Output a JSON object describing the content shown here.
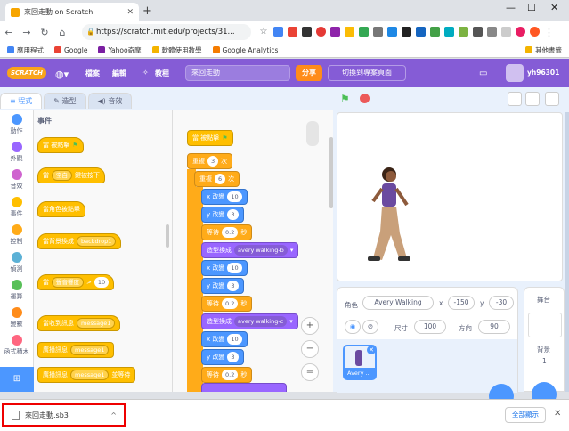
{
  "browser": {
    "tab_title": "來回走動 on Scratch",
    "url": "https://scratch.mit.edu/projects/31...",
    "bookmarks": [
      "應用程式",
      "Google",
      "Yahoo奇摩",
      "軟體使用教學",
      "Google Analytics"
    ],
    "other_bookmarks": "其他書籤"
  },
  "scratch": {
    "menu": {
      "file": "檔案",
      "edit": "編輯",
      "tutorials": "教程",
      "share": "分享",
      "see_page": "切換到專案頁面",
      "username": "yh96301"
    },
    "project_title": "來回走動",
    "tabs": [
      "程式",
      "造型",
      "音效"
    ],
    "categories": [
      {
        "label": "動作",
        "color": "#4c97ff"
      },
      {
        "label": "外觀",
        "color": "#9966ff"
      },
      {
        "label": "音效",
        "color": "#cf63cf"
      },
      {
        "label": "事件",
        "color": "#ffbf00"
      },
      {
        "label": "控制",
        "color": "#ffab19"
      },
      {
        "label": "偵測",
        "color": "#5cb1d6"
      },
      {
        "label": "運算",
        "color": "#59c059"
      },
      {
        "label": "變數",
        "color": "#ff8c1a"
      },
      {
        "label": "函式積木",
        "color": "#ff6680"
      }
    ],
    "palette": {
      "heading": "事件",
      "blocks": {
        "flag_clicked": "當 被點擊",
        "when_key": "當",
        "key_value": "空白",
        "key_pressed": "鍵被按下",
        "sprite_clicked": "當角色被點擊",
        "backdrop_switch": "當背景換成",
        "backdrop_value": "backdrop1",
        "when_loudness": "當",
        "loudness": "聲音響度",
        "gt": ">",
        "gt_value": "10",
        "receive": "當收到訊息",
        "receive_value": "message1",
        "broadcast": "廣播訊息",
        "broadcast_value": "message1",
        "broadcast_wait": "廣播訊息",
        "broadcast_wait_value": "message1",
        "broadcast_wait_tail": "並等待"
      }
    },
    "script": {
      "hat": "當 被點擊",
      "repeat1_a": "重複",
      "repeat1_n": "3",
      "repeat1_b": "次",
      "repeat2_a": "重複",
      "repeat2_n": "6",
      "repeat2_b": "次",
      "changex": "x 改變",
      "changex_v": "10",
      "changey": "y 改變",
      "changey_v": "3",
      "wait": "等待",
      "wait_v": "0.2",
      "wait_unit": "秒",
      "costume": "造型換成",
      "costume_b": "avery walking-b",
      "costume_c": "avery walking-c"
    },
    "sprite_info": {
      "sprite_label": "角色",
      "sprite_name": "Avery Walking",
      "x_label": "x",
      "x": "-150",
      "y_label": "y",
      "y": "-30",
      "show_label": "顯示",
      "size_label": "尺寸",
      "size": "100",
      "direction_label": "方向",
      "direction": "90",
      "thumb_name": "Avery ..."
    },
    "stage_pane": {
      "label": "舞台",
      "backdrops_label": "背景",
      "backdrops_count": "1"
    }
  },
  "download": {
    "filename": "來回走動.sb3",
    "show_all": "全部顯示"
  }
}
